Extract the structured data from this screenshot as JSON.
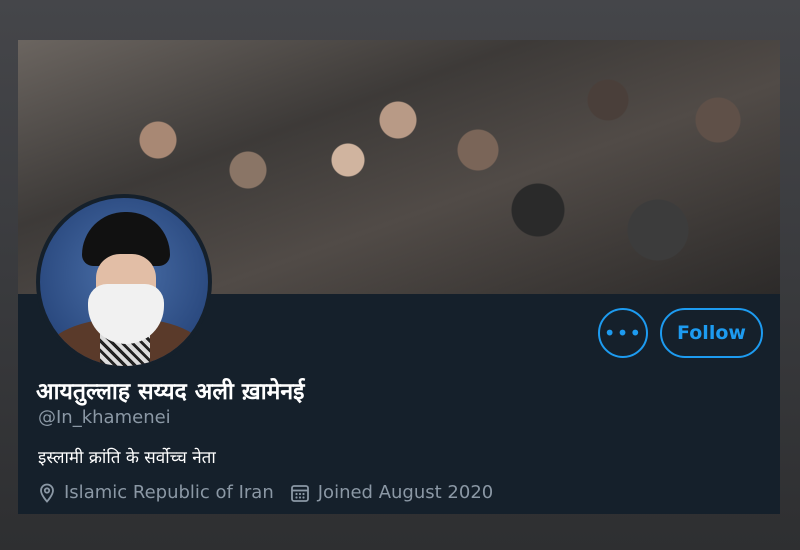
{
  "profile": {
    "display_name": "आयतुल्लाह सय्यद अली ख़ामेनई",
    "handle": "@In_khamenei",
    "bio": "इस्लामी क्रांति के सर्वोच्च नेता",
    "location": "Islamic Republic of Iran",
    "joined": "Joined August 2020"
  },
  "actions": {
    "more_label": "•••",
    "follow_label": "Follow"
  },
  "colors": {
    "background": "#15202b",
    "accent": "#1d9bf0",
    "secondary_text": "#8b98a5"
  },
  "icons": {
    "location": "location-pin-icon",
    "calendar": "calendar-icon"
  }
}
